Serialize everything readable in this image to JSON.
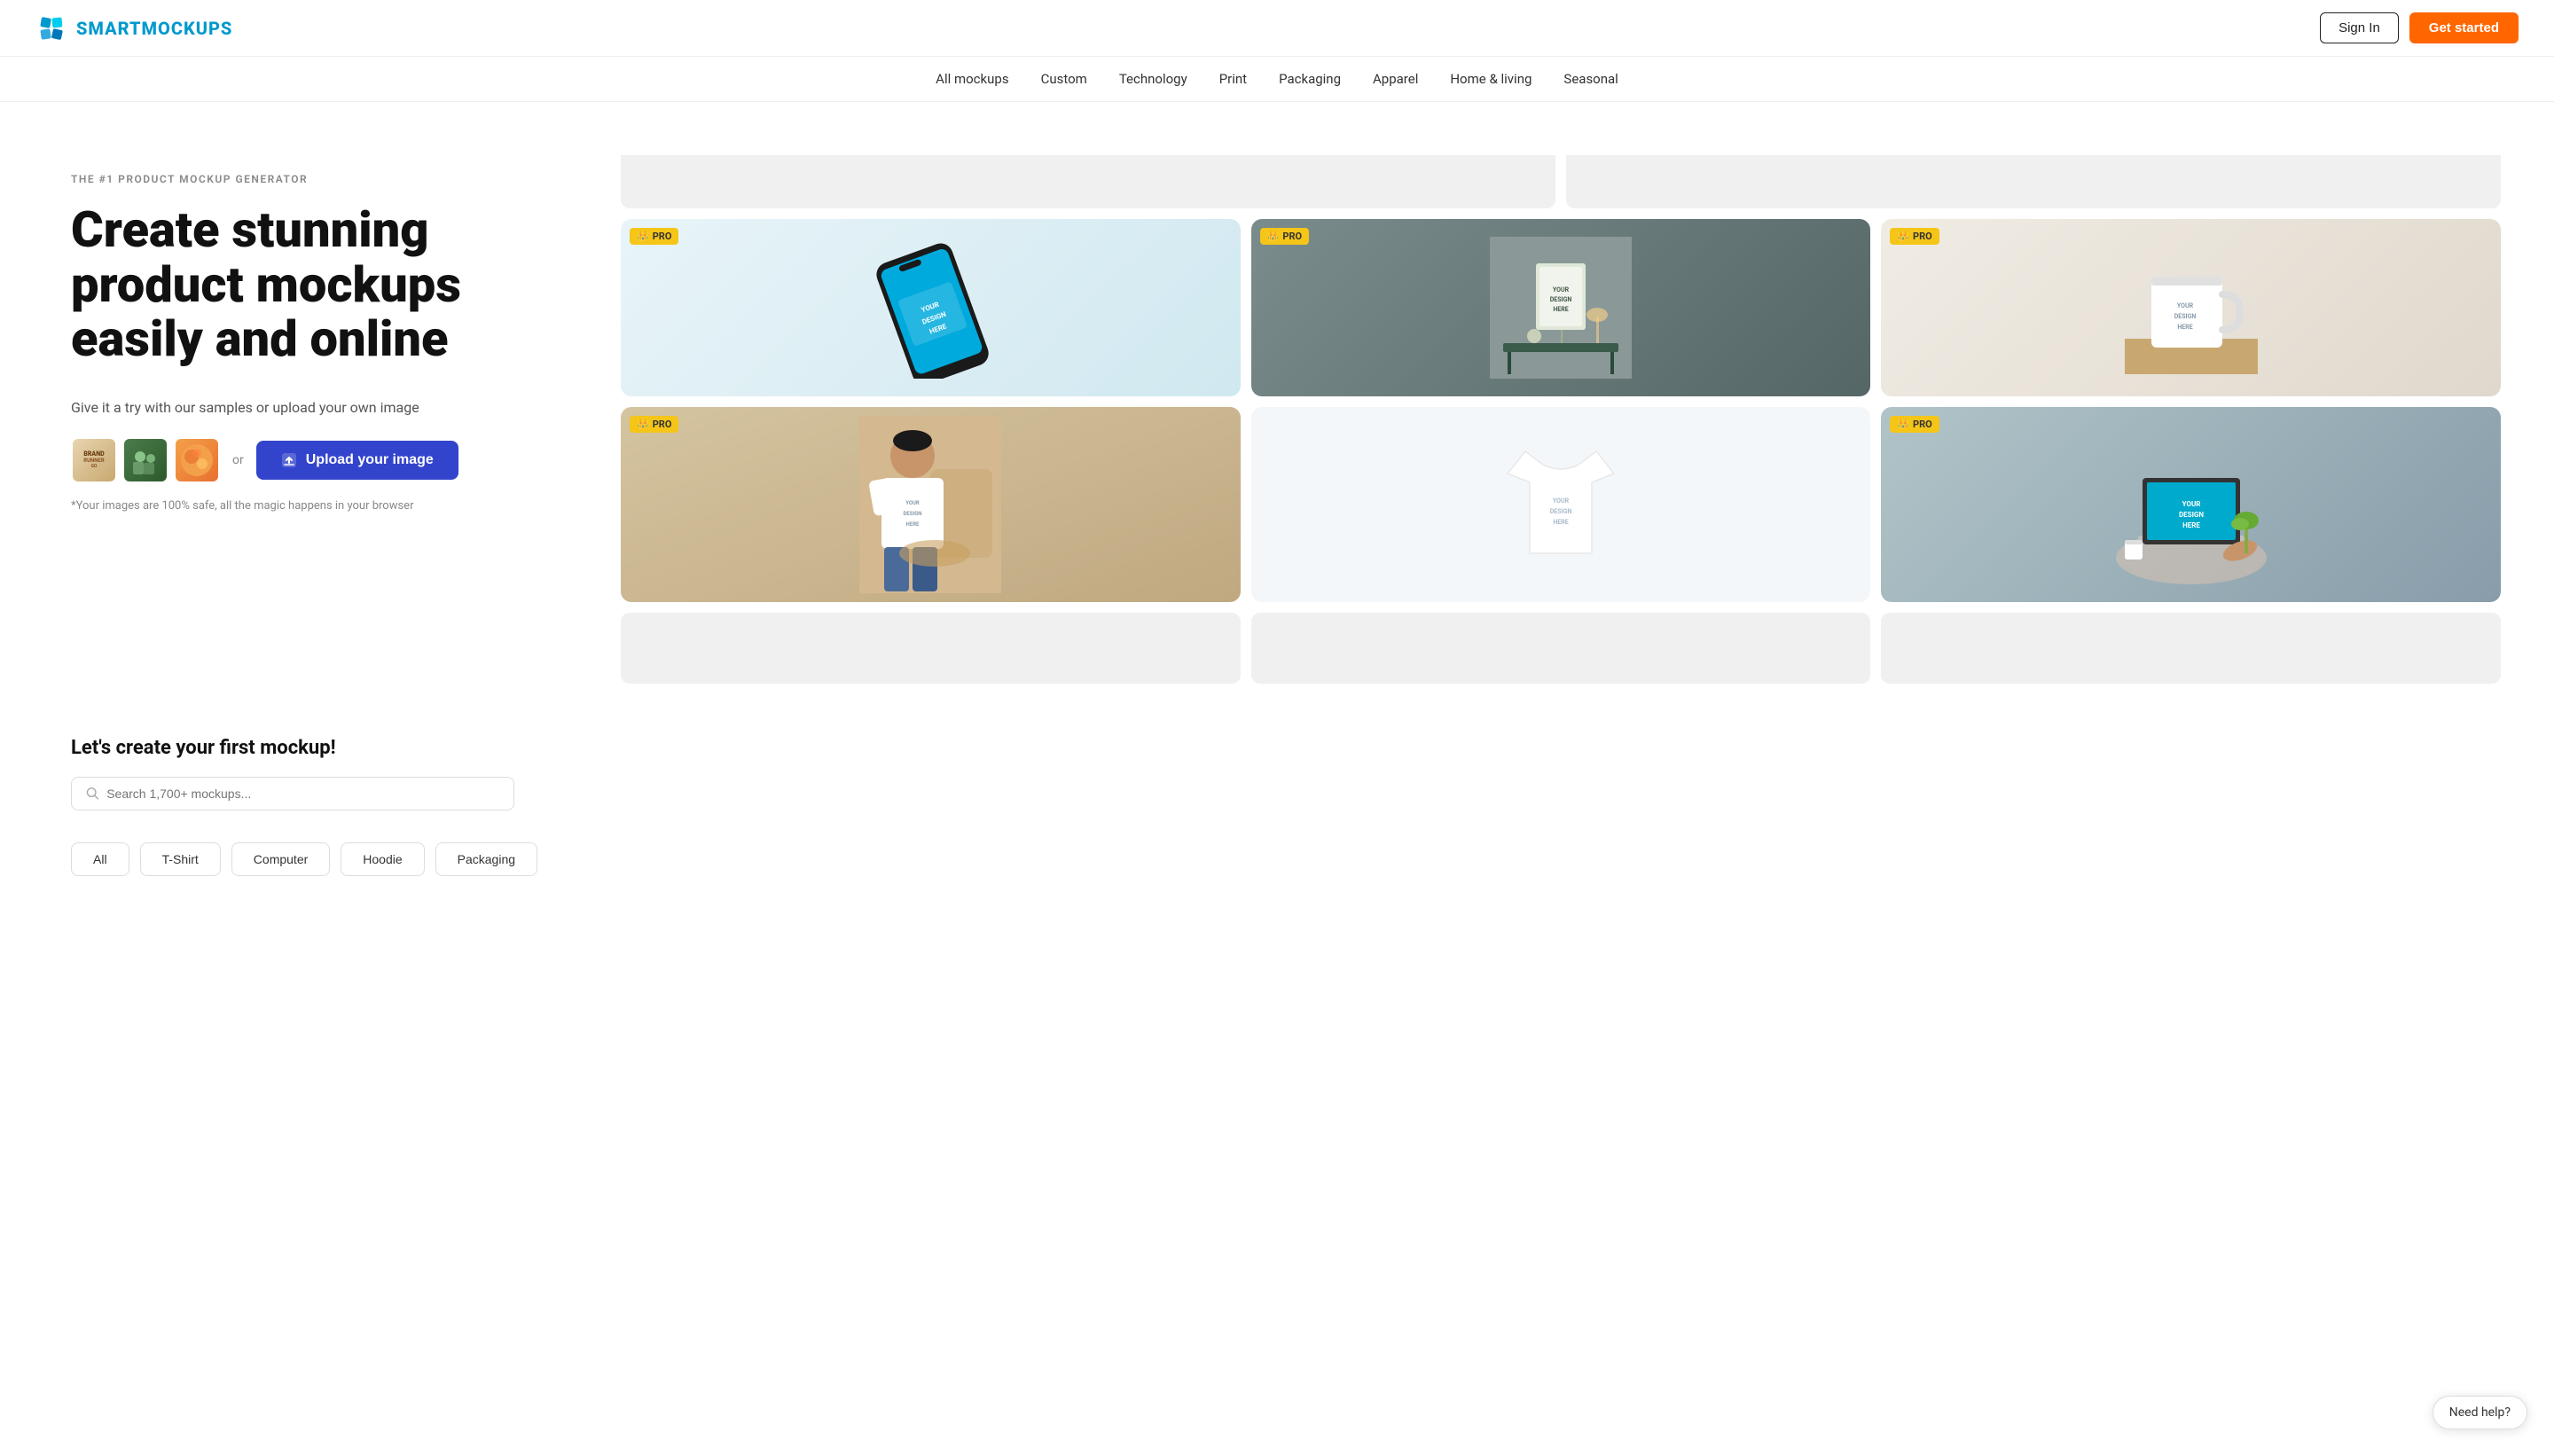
{
  "header": {
    "logo_text": "SMARTMOCKUPS",
    "signin_label": "Sign In",
    "getstarted_label": "Get started"
  },
  "nav": {
    "items": [
      {
        "label": "All mockups",
        "id": "all-mockups"
      },
      {
        "label": "Custom",
        "id": "custom"
      },
      {
        "label": "Technology",
        "id": "technology"
      },
      {
        "label": "Print",
        "id": "print"
      },
      {
        "label": "Packaging",
        "id": "packaging"
      },
      {
        "label": "Apparel",
        "id": "apparel"
      },
      {
        "label": "Home & living",
        "id": "home-living"
      },
      {
        "label": "Seasonal",
        "id": "seasonal"
      }
    ]
  },
  "hero": {
    "tagline": "THE #1 PRODUCT MOCKUP GENERATOR",
    "title": "Create stunning product mockups easily and online",
    "subtitle": "Give it a try with our samples or upload your own image",
    "or_text": "or",
    "upload_label": "Upload your image",
    "safety_note": "*Your images are 100% safe, all the magic happens in your browser",
    "samples": [
      {
        "id": "sample-1",
        "label": "Brand Runner Go"
      },
      {
        "id": "sample-2",
        "label": "People outdoors"
      },
      {
        "id": "sample-3",
        "label": "Abstract art"
      }
    ]
  },
  "mockups": {
    "pro_badge": "PRO",
    "design_text": "YOUR\nDESIGN\nHERE",
    "cards": [
      {
        "id": "phone",
        "type": "phone",
        "pro": true,
        "bg": "#e8f4f8"
      },
      {
        "id": "poster",
        "type": "poster",
        "pro": true,
        "bg": "#6b8080"
      },
      {
        "id": "mug",
        "type": "mug",
        "pro": true,
        "bg": "#f0ece4"
      },
      {
        "id": "person",
        "type": "person",
        "pro": true,
        "bg": "#c8b898"
      },
      {
        "id": "tshirt",
        "type": "tshirt",
        "pro": false,
        "bg": "#f0f4f8"
      },
      {
        "id": "laptop",
        "type": "laptop",
        "pro": true,
        "bg": "#a8b8c0"
      }
    ]
  },
  "bottom": {
    "title": "Let's create your first mockup!",
    "search_placeholder": "Search 1,700+ mockups...",
    "categories": [
      {
        "label": "All"
      },
      {
        "label": "T-Shirt"
      },
      {
        "label": "Computer"
      },
      {
        "label": "Hoodie"
      },
      {
        "label": "Packaging"
      }
    ]
  },
  "need_help": "Need help?"
}
